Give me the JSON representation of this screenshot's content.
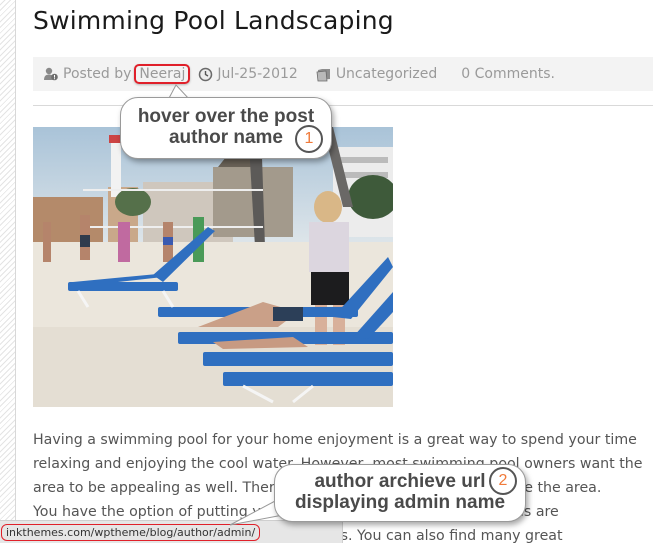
{
  "post": {
    "title": "Swimming Pool Landscaping",
    "meta": {
      "posted_by_label": "Posted by",
      "author": "Neeraj",
      "date": "Jul-25-2012",
      "category": "Uncategorized",
      "comments": "0 Comments.",
      "icons": {
        "author": "user-icon",
        "date": "clock-icon",
        "category": "folder-icon"
      }
    },
    "image": {
      "description": "Beach with blue sun loungers, people standing and lying, volleyball net and buildings in background"
    },
    "body_lines": [
      "Having a swimming pool for your home enjoyment is a great way to spend your time",
      "relaxing and enjoying the cool water. However, most swimming pool owners want the",
      "area to be appealing as well. There are many ways you can landscape the area.",
      "You have the option of putting your own touch to it and great supplies are",
      "available at most home improvement stores. You can also find many great"
    ]
  },
  "annotations": [
    {
      "step": "1",
      "line1": "hover over the post",
      "line2": "author name"
    },
    {
      "step": "2",
      "line1": "author archieve url",
      "line2": "displaying admin name"
    }
  ],
  "status_bar": {
    "url": "inkthemes.com/wptheme/blog/author/admin/"
  },
  "colors": {
    "highlight": "#e0202a",
    "step_number": "#f07a3a",
    "meta_text": "#9a9a9a",
    "body_text": "#555555"
  }
}
